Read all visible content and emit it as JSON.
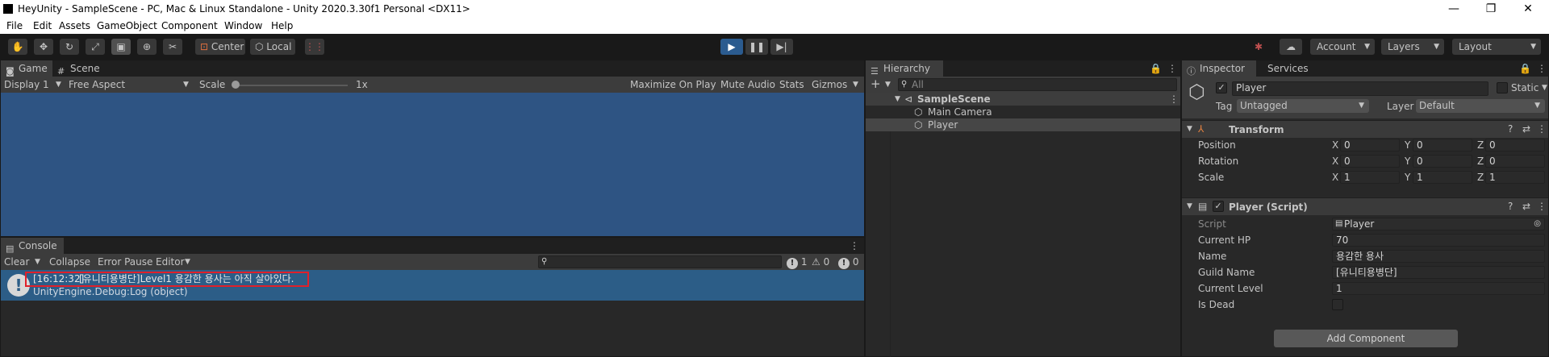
{
  "window": {
    "title": "HeyUnity - SampleScene - PC, Mac & Linux Standalone - Unity 2020.3.30f1 Personal <DX11>",
    "minimize": "—",
    "maximize": "❐",
    "close": "✕"
  },
  "menu": [
    "File",
    "Edit",
    "Assets",
    "GameObject",
    "Component",
    "Window",
    "Help"
  ],
  "toolbar": {
    "pivot": "Center",
    "space": "Local",
    "account": "Account",
    "layers": "Layers",
    "layout": "Layout"
  },
  "game": {
    "tabs": [
      "Game",
      "Scene"
    ],
    "display": "Display 1",
    "aspect": "Free Aspect",
    "scale_label": "Scale",
    "scale_value": "1x",
    "buttons": [
      "Maximize On Play",
      "Mute Audio",
      "Stats",
      "Gizmos"
    ],
    "view_color": "#2e5483"
  },
  "console": {
    "tab": "Console",
    "buttons": [
      "Clear",
      "Collapse",
      "Error Pause",
      "Editor"
    ],
    "counts": {
      "logs": "1",
      "warnings": "0",
      "errors": "0"
    },
    "entry": {
      "time": "[16:12:32]",
      "message": "[유니티용병단]Level1 용감한 용사는 아직 살아있다.",
      "source": "UnityEngine.Debug:Log (object)"
    },
    "highlight_color": "#e0202a"
  },
  "hierarchy": {
    "tab": "Hierarchy",
    "search_placeholder": "All",
    "scene": "SampleScene",
    "items": [
      "Main Camera",
      "Player"
    ]
  },
  "inspector": {
    "tabs": [
      "Inspector",
      "Services"
    ],
    "object_name": "Player",
    "static_label": "Static",
    "tag_label": "Tag",
    "tag_value": "Untagged",
    "layer_label": "Layer",
    "layer_value": "Default",
    "transform": {
      "title": "Transform",
      "rows": [
        {
          "label": "Position",
          "x": "0",
          "y": "0",
          "z": "0"
        },
        {
          "label": "Rotation",
          "x": "0",
          "y": "0",
          "z": "0"
        },
        {
          "label": "Scale",
          "x": "1",
          "y": "1",
          "z": "1"
        }
      ]
    },
    "script": {
      "title": "Player (Script)",
      "fields": [
        {
          "label": "Script",
          "value": "Player"
        },
        {
          "label": "Current HP",
          "value": "70"
        },
        {
          "label": "Name",
          "value": "용감한 용사"
        },
        {
          "label": "Guild Name",
          "value": "[유니티용병단]"
        },
        {
          "label": "Current Level",
          "value": "1"
        },
        {
          "label": "Is Dead",
          "value": ""
        }
      ]
    },
    "add_component": "Add Component"
  }
}
